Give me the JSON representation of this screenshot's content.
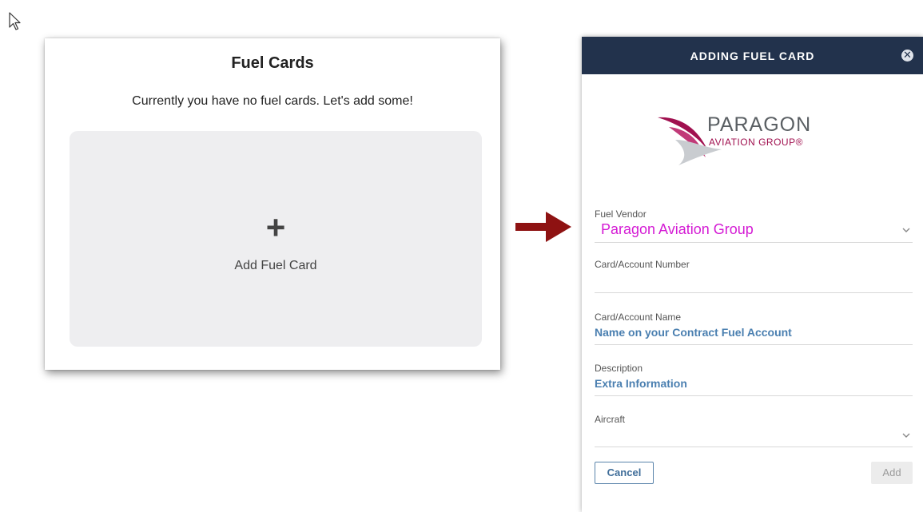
{
  "fuel_cards": {
    "title": "Fuel Cards",
    "empty_message": "Currently you have no fuel cards. Let's add some!",
    "add_button_label": "Add Fuel Card",
    "add_icon": "plus-icon"
  },
  "modal": {
    "title": "ADDING FUEL CARD",
    "close_icon": "close-icon",
    "logo": {
      "name": "PARAGON",
      "subtitle": "AVIATION GROUP®"
    },
    "fields": {
      "fuel_vendor": {
        "label": "Fuel Vendor",
        "value": "Paragon Aviation Group"
      },
      "card_number": {
        "label": "Card/Account Number",
        "value": ""
      },
      "card_name": {
        "label": "Card/Account Name",
        "value": "Name on your Contract Fuel Account"
      },
      "description": {
        "label": "Description",
        "value": "Extra Information"
      },
      "aircraft": {
        "label": "Aircraft",
        "value": ""
      }
    },
    "buttons": {
      "cancel": "Cancel",
      "add": "Add"
    }
  },
  "colors": {
    "header": "#22324c",
    "annotation_magenta": "#d41bd4",
    "arrow_red": "#8e1212",
    "value_blue": "#4a7fb0"
  }
}
